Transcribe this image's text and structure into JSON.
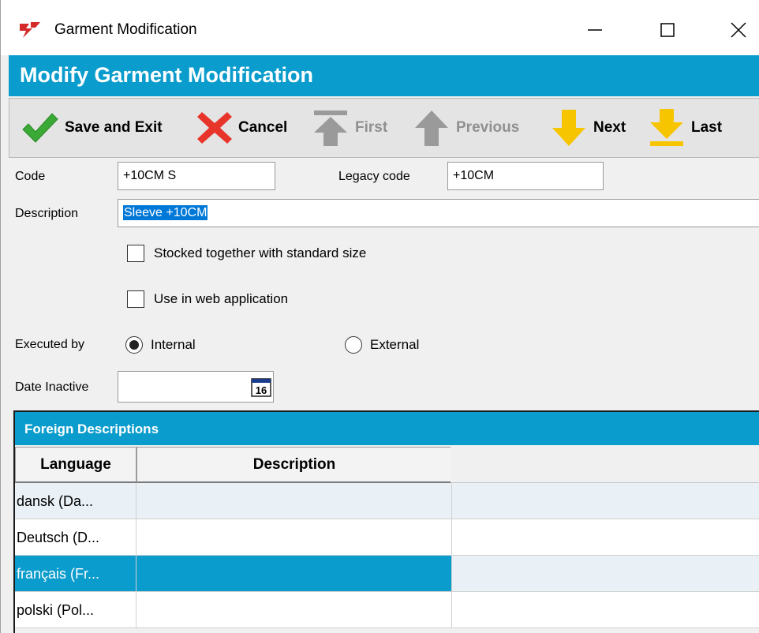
{
  "window": {
    "title": "Garment Modification"
  },
  "header": {
    "title": "Modify Garment Modification"
  },
  "toolbar": {
    "save_label": "Save and Exit",
    "cancel_label": "Cancel",
    "first_label": "First",
    "previous_label": "Previous",
    "next_label": "Next",
    "last_label": "Last"
  },
  "form": {
    "code_label": "Code",
    "code_value": "+10CM S",
    "legacy_label": "Legacy code",
    "legacy_value": "+10CM",
    "description_label": "Description",
    "description_value": "Sleeve +10CM",
    "stocked_label": "Stocked together with standard size",
    "stocked_checked": false,
    "web_label": "Use in web application",
    "web_checked": false,
    "executed_label": "Executed by",
    "internal_label": "Internal",
    "external_label": "External",
    "executed_value": "Internal",
    "date_inactive_label": "Date Inactive",
    "date_inactive_value": "",
    "calendar_day": "16"
  },
  "foreign": {
    "title": "Foreign Descriptions",
    "columns": [
      "Language",
      "Description"
    ],
    "rows": [
      {
        "language": "dansk (Da...",
        "description": ""
      },
      {
        "language": "Deutsch (D...",
        "description": ""
      },
      {
        "language": "français (Fr...",
        "description": ""
      },
      {
        "language": "polski (Pol...",
        "description": ""
      }
    ],
    "selected_row": 2
  },
  "colors": {
    "accent": "#0a9ccc",
    "save_green": "#3aa935",
    "cancel_red": "#e8352b",
    "nav_yellow": "#f7c500",
    "disabled_gray": "#909090"
  }
}
